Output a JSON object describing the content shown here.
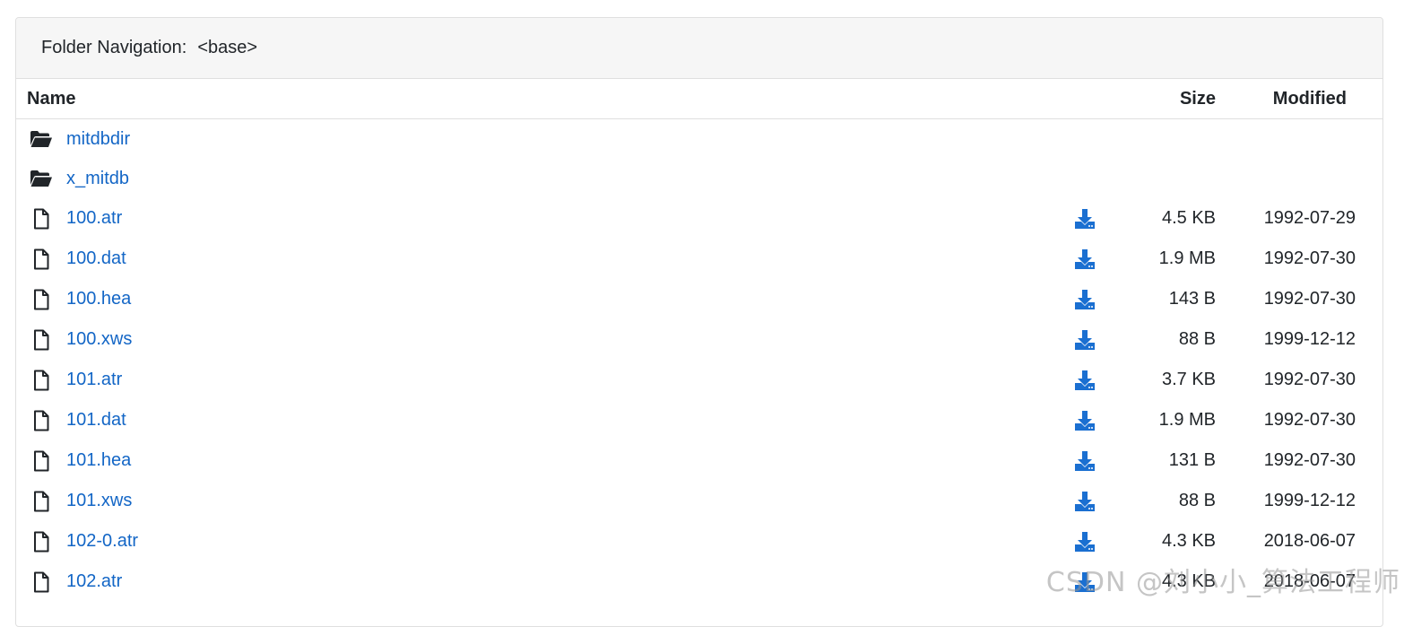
{
  "header": {
    "nav_label": "Folder Navigation:",
    "nav_path": "<base>"
  },
  "columns": {
    "name": "Name",
    "size": "Size",
    "modified": "Modified"
  },
  "colors": {
    "link": "#1366c6",
    "download_icon": "#1a6fd1",
    "header_bg": "#f6f6f6",
    "border": "#dfdfdf"
  },
  "folders": [
    {
      "name": "mitdbdir",
      "icon": "folder-open-icon"
    },
    {
      "name": "x_mitdb",
      "icon": "folder-open-icon"
    }
  ],
  "files": [
    {
      "name": "100.atr",
      "size": "4.5 KB",
      "modified": "1992-07-29",
      "icon": "file-icon"
    },
    {
      "name": "100.dat",
      "size": "1.9 MB",
      "modified": "1992-07-30",
      "icon": "file-icon"
    },
    {
      "name": "100.hea",
      "size": "143 B",
      "modified": "1992-07-30",
      "icon": "file-icon"
    },
    {
      "name": "100.xws",
      "size": "88 B",
      "modified": "1999-12-12",
      "icon": "file-icon"
    },
    {
      "name": "101.atr",
      "size": "3.7 KB",
      "modified": "1992-07-30",
      "icon": "file-icon"
    },
    {
      "name": "101.dat",
      "size": "1.9 MB",
      "modified": "1992-07-30",
      "icon": "file-icon"
    },
    {
      "name": "101.hea",
      "size": "131 B",
      "modified": "1992-07-30",
      "icon": "file-icon"
    },
    {
      "name": "101.xws",
      "size": "88 B",
      "modified": "1999-12-12",
      "icon": "file-icon"
    },
    {
      "name": "102-0.atr",
      "size": "4.3 KB",
      "modified": "2018-06-07",
      "icon": "file-icon"
    },
    {
      "name": "102.atr",
      "size": "4.3 KB",
      "modified": "2018-06-07",
      "icon": "file-icon"
    }
  ],
  "watermark": "CSDN @刘小小_算法工程师"
}
